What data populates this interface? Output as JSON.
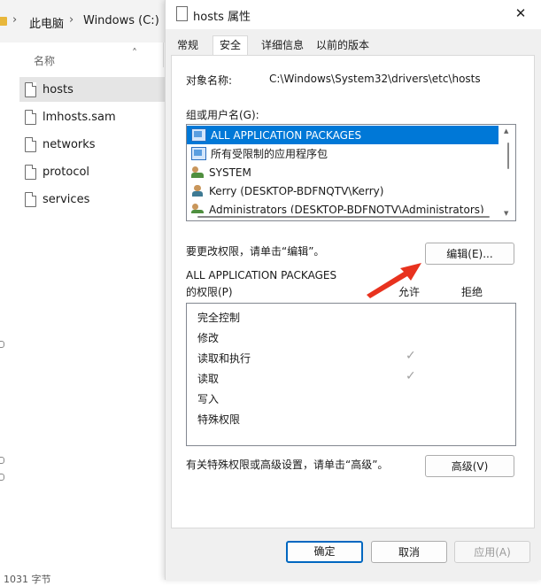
{
  "explorer": {
    "breadcrumbs": [
      "此电脑",
      "Windows (C:)"
    ],
    "column_header": "名称",
    "files": [
      {
        "name": "hosts",
        "selected": true
      },
      {
        "name": "lmhosts.sam",
        "selected": false
      },
      {
        "name": "networks",
        "selected": false
      },
      {
        "name": "protocol",
        "selected": false
      },
      {
        "name": "services",
        "selected": false
      }
    ],
    "bottom_text": "1031 字节"
  },
  "dialog": {
    "title": "hosts 属性",
    "close_glyph": "✕",
    "tabs": [
      {
        "label": "常规",
        "active": false
      },
      {
        "label": "安全",
        "active": true
      },
      {
        "label": "详细信息",
        "active": false
      },
      {
        "label": "以前的版本",
        "active": false
      }
    ],
    "object_label": "对象名称:",
    "object_value": "C:\\Windows\\System32\\drivers\\etc\\hosts",
    "group_label": "组或用户名(G):",
    "groups": [
      {
        "name": "ALL APPLICATION PACKAGES",
        "icon": "package-icon",
        "selected": true
      },
      {
        "name": "所有受限制的应用程序包",
        "icon": "package-icon",
        "selected": false
      },
      {
        "name": "SYSTEM",
        "icon": "users-icon",
        "selected": false
      },
      {
        "name": "Kerry (DESKTOP-BDFNQTV\\Kerry)",
        "icon": "user-icon",
        "selected": false
      },
      {
        "name": "Administrators (DESKTOP-BDFNQTV\\Administrators)",
        "icon": "users-icon",
        "selected": false
      }
    ],
    "change_hint": "要更改权限，请单击“编辑”。",
    "edit_button": "编辑(E)...",
    "perm_header_line1": "ALL APPLICATION PACKAGES",
    "perm_header_line2": "的权限(P)",
    "allow_label": "允许",
    "deny_label": "拒绝",
    "permissions": [
      {
        "name": "完全控制",
        "allow": false,
        "deny": false
      },
      {
        "name": "修改",
        "allow": false,
        "deny": false
      },
      {
        "name": "读取和执行",
        "allow": true,
        "deny": false
      },
      {
        "name": "读取",
        "allow": true,
        "deny": false
      },
      {
        "name": "写入",
        "allow": false,
        "deny": false
      },
      {
        "name": "特殊权限",
        "allow": false,
        "deny": false
      }
    ],
    "check_glyph": "✓",
    "advanced_hint": "有关特殊权限或高级设置，请单击“高级”。",
    "advanced_button": "高级(V)",
    "ok_button": "确定",
    "cancel_button": "取消",
    "apply_button": "应用(A)",
    "annotation_arrow_color": "#e8321e",
    "accent_color": "#0078d7"
  }
}
